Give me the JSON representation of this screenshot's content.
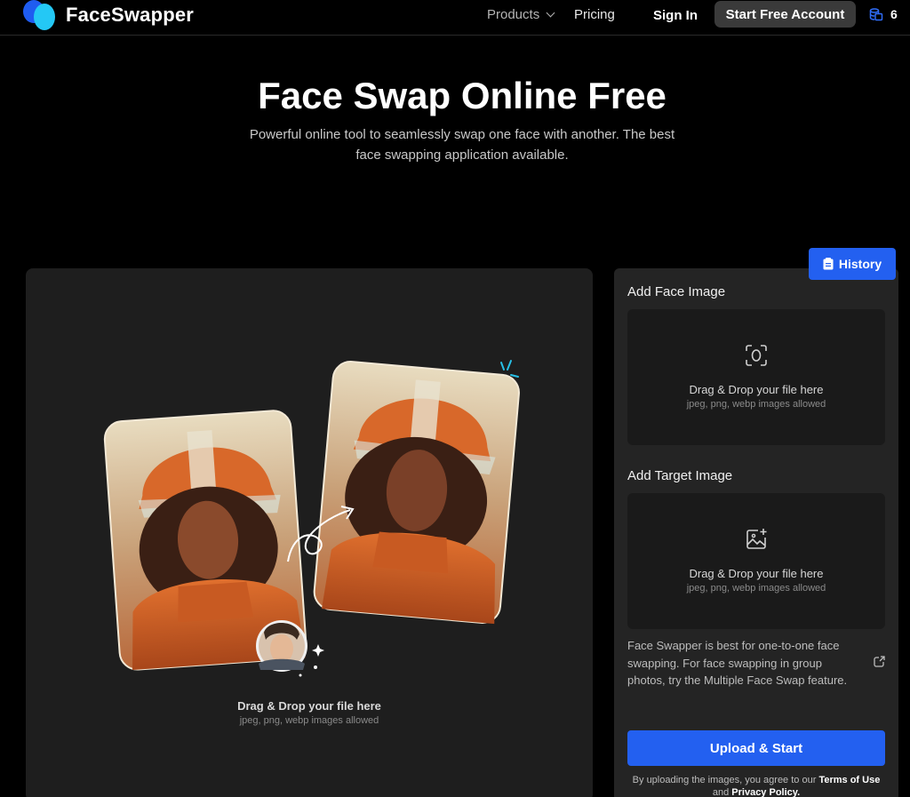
{
  "header": {
    "brand": "FaceSwapper",
    "nav_products": "Products",
    "nav_pricing": "Pricing",
    "sign_in": "Sign In",
    "start_free": "Start Free Account",
    "credits": "6",
    "logo_colors": [
      "#1f5cf0",
      "#24c8f5"
    ]
  },
  "hero": {
    "title": "Face Swap Online Free",
    "subtitle": "Powerful online tool to seamlessly swap one face with another. The best face swapping application available."
  },
  "left_panel": {
    "drop_text": "Drag & Drop your file here",
    "drop_hint": "jpeg, png, webp images allowed"
  },
  "right_panel": {
    "history": "History",
    "face_label": "Add Face Image",
    "face_drop_text": "Drag & Drop your file here",
    "face_drop_hint": "jpeg, png, webp images allowed",
    "target_label": "Add Target Image",
    "target_drop_text": "Drag & Drop your file here",
    "target_drop_hint": "jpeg, png, webp images allowed",
    "note": "Face Swapper is best for one-to-one face swapping. For face swapping in group photos, try the Multiple Face Swap feature.",
    "upload_button": "Upload & Start",
    "terms_prefix": "By uploading the images, you agree to our",
    "terms_link": "Terms of Use",
    "terms_and": "and",
    "privacy_link": "Privacy Policy."
  },
  "colors": {
    "accent": "#2360f0",
    "background": "#000000",
    "panel": "#1e1e1e"
  }
}
